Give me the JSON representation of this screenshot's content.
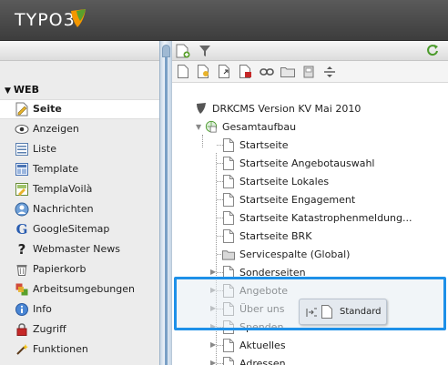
{
  "header": {
    "logo_text": "TYPO3"
  },
  "modmenu": {
    "section_label": "WEB",
    "items": [
      {
        "label": "Seite",
        "icon": "page-module-icon",
        "active": true
      },
      {
        "label": "Anzeigen",
        "icon": "eye-icon"
      },
      {
        "label": "Liste",
        "icon": "list-icon"
      },
      {
        "label": "Template",
        "icon": "template-icon"
      },
      {
        "label": "TemplaVoilà",
        "icon": "templavoila-icon"
      },
      {
        "label": "Nachrichten",
        "icon": "news-icon"
      },
      {
        "label": "GoogleSitemap",
        "icon": "google-icon"
      },
      {
        "label": "Webmaster News",
        "icon": "webmaster-icon"
      },
      {
        "label": "Papierkorb",
        "icon": "trash-icon"
      },
      {
        "label": "Arbeitsumgebungen",
        "icon": "workspace-icon"
      },
      {
        "label": "Info",
        "icon": "info-icon"
      },
      {
        "label": "Zugriff",
        "icon": "lock-icon"
      },
      {
        "label": "Funktionen",
        "icon": "wand-icon"
      }
    ]
  },
  "tree": {
    "root_label": "DRKCMS Version KV Mai 2010",
    "site_label": "Gesamtaufbau",
    "pages": [
      {
        "label": "Startseite"
      },
      {
        "label": "Startseite Angebotauswahl"
      },
      {
        "label": "Startseite Lokales"
      },
      {
        "label": "Startseite Engagement"
      },
      {
        "label": "Startseite Katastrophenmeldung..."
      },
      {
        "label": "Startseite BRK"
      },
      {
        "label": "Servicespalte (Global)"
      },
      {
        "label": "Sonderseiten"
      },
      {
        "label": "Angebote"
      },
      {
        "label": "Über uns"
      },
      {
        "label": "Spenden"
      },
      {
        "label": "Aktuelles"
      },
      {
        "label": "Adressen"
      }
    ]
  },
  "drag": {
    "label": "Standard"
  },
  "colors": {
    "drop_highlight": "#1e90e8",
    "topbar": "#474747",
    "accent_orange": "#f49700"
  }
}
